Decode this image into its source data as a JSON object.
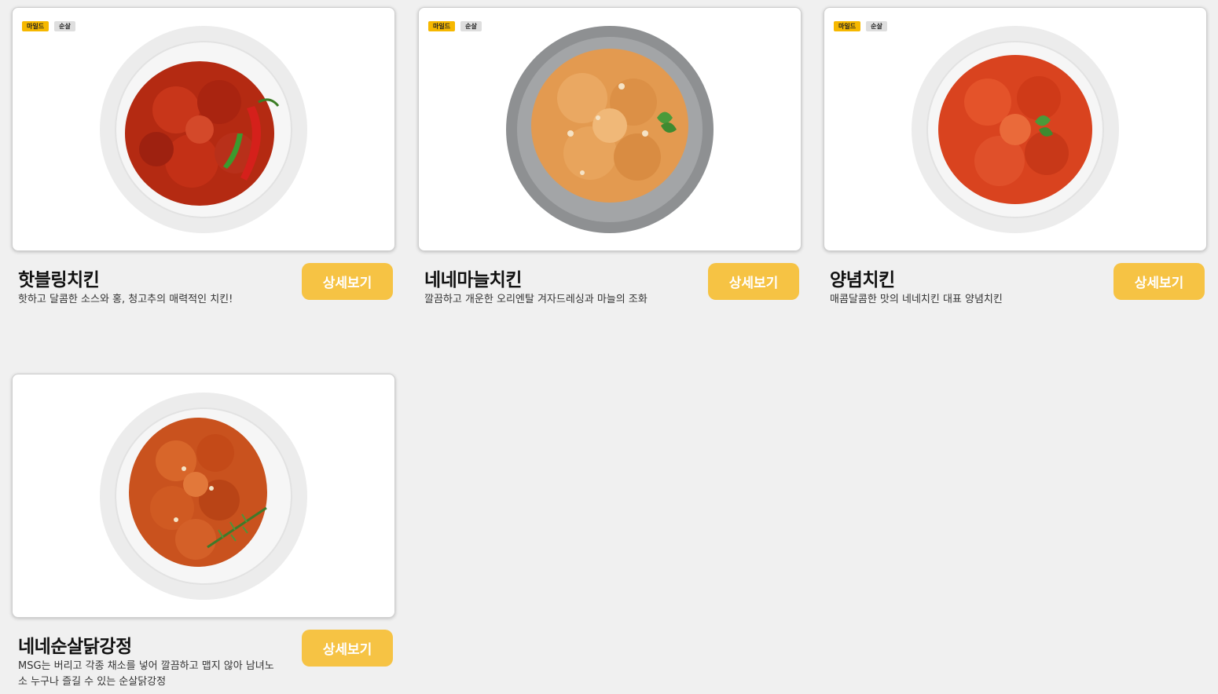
{
  "menu_items": [
    {
      "tags": [
        "마일드",
        "순살"
      ],
      "name": "핫블링치킨",
      "description": "핫하고 달콤한 소스와 홍, 청고추의 매력적인 치킨!",
      "button": "상세보기",
      "image_icon": "hot-chicken-plate-image"
    },
    {
      "tags": [
        "마일드",
        "순살"
      ],
      "name": "네네마늘치킨",
      "description": "깔끔하고 개운한 오리엔탈 겨자드레싱과 마늘의 조화",
      "button": "상세보기",
      "image_icon": "garlic-chicken-plate-image"
    },
    {
      "tags": [
        "마일드",
        "순살"
      ],
      "name": "양념치킨",
      "description": "매콤달콤한 맛의 네네치킨 대표 양념치킨",
      "button": "상세보기",
      "image_icon": "seasoned-chicken-plate-image"
    },
    {
      "tags": [],
      "name": "네네순살닭강정",
      "description": "MSG는 버리고 각종 채소를 넣어 깔끔하고 맵지 않아 남녀노소 누구나 즐길 수 있는 순살닭강정",
      "button": "상세보기",
      "image_icon": "boneless-dakgangjeong-plate-image"
    }
  ],
  "colors": {
    "page_background": "#f0f0f0",
    "button": "#f6c344",
    "tag_mild": "#f6b800",
    "tag_boneless": "#dedede"
  }
}
